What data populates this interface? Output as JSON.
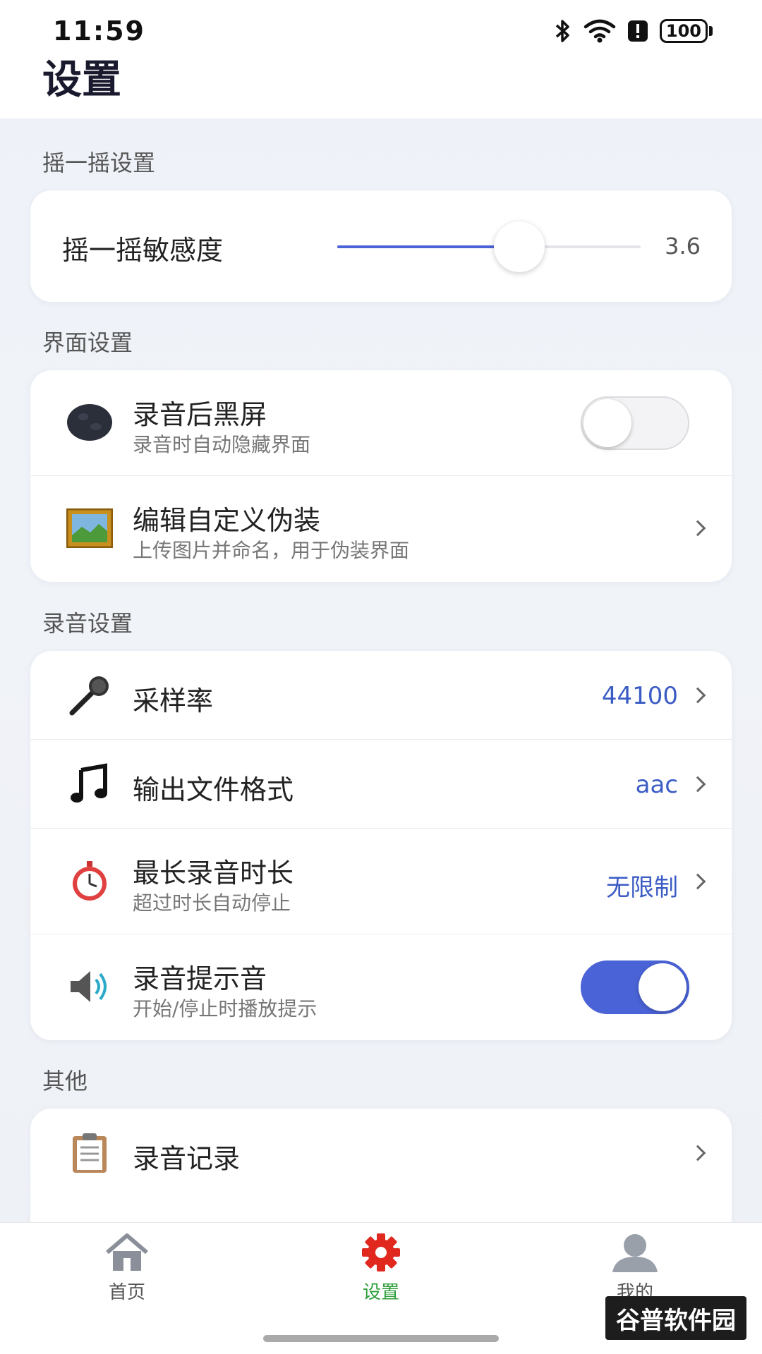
{
  "status_bar": {
    "time": "11:59",
    "battery": "100"
  },
  "page_title": "设置",
  "sections": {
    "shake": {
      "label": "摇一摇设置",
      "sensitivity": {
        "label": "摇一摇敏感度",
        "value": "3.6",
        "fill_fraction": 0.6
      }
    },
    "interface": {
      "label": "界面设置",
      "black_screen": {
        "title": "录音后黑屏",
        "subtitle": "录音时自动隐藏界面",
        "enabled": false
      },
      "disguise": {
        "title": "编辑自定义伪装",
        "subtitle": "上传图片并命名，用于伪装界面"
      }
    },
    "recording": {
      "label": "录音设置",
      "sample_rate": {
        "title": "采样率",
        "value": "44100"
      },
      "format": {
        "title": "输出文件格式",
        "value": "aac"
      },
      "max_duration": {
        "title": "最长录音时长",
        "subtitle": "超过时长自动停止",
        "value": "无限制"
      },
      "prompt_sound": {
        "title": "录音提示音",
        "subtitle": "开始/停止时播放提示",
        "enabled": true
      }
    },
    "other": {
      "label": "其他",
      "records": {
        "title": "录音记录"
      }
    }
  },
  "tabbar": {
    "home": "首页",
    "settings": "设置",
    "mine": "我的"
  },
  "watermark": "谷普软件园",
  "colors": {
    "accent": "#4a63d6",
    "value_blue": "#3b5cc4",
    "tab_active": "#2e9e3a",
    "gear_red": "#e0281e"
  }
}
